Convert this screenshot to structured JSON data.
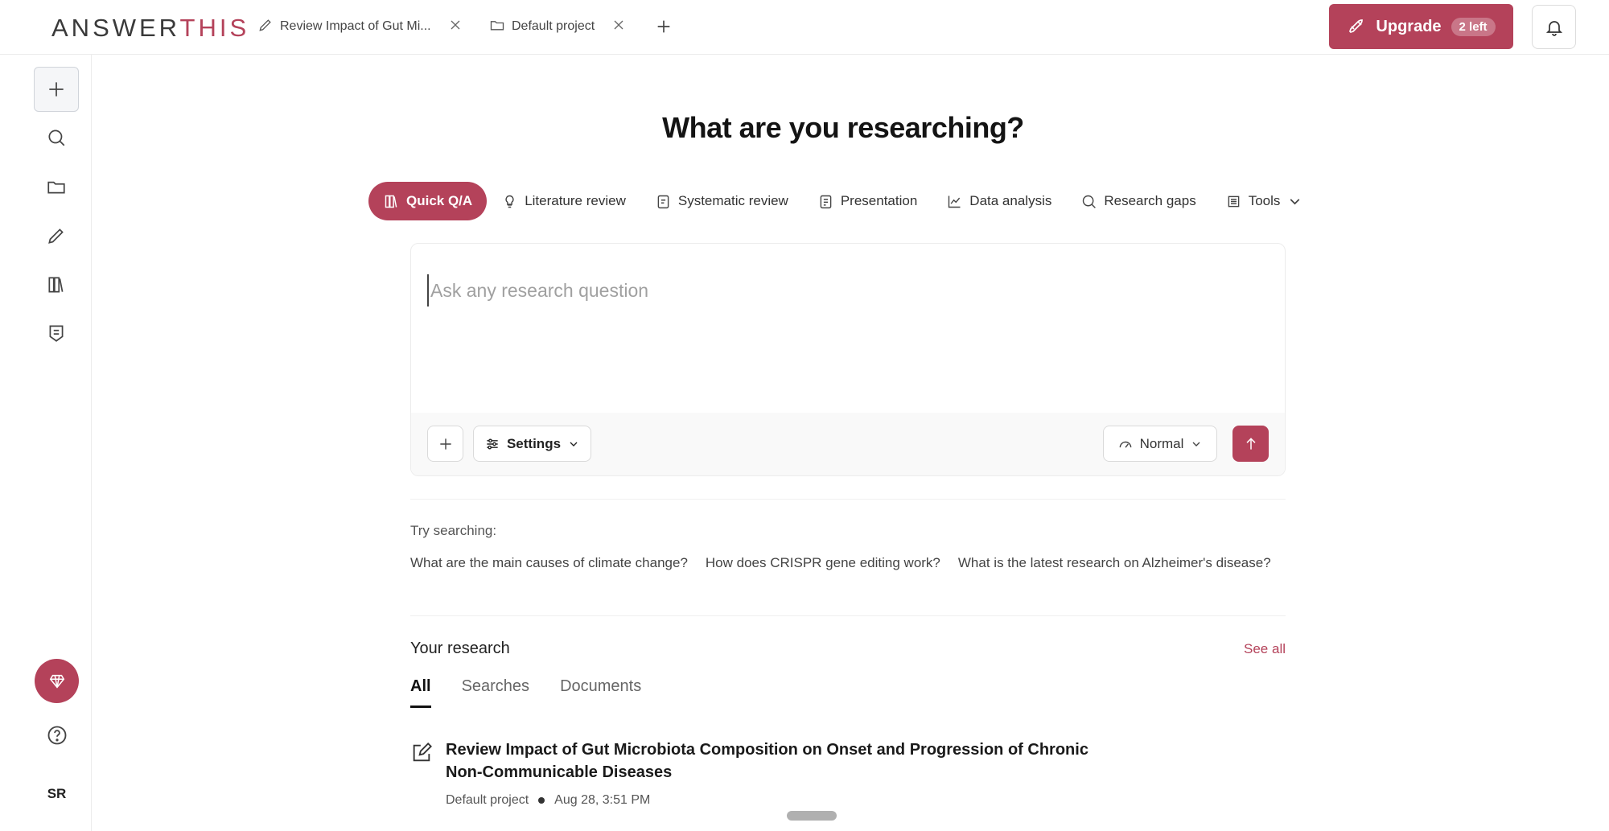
{
  "brand": {
    "logo_main": "ANSWER",
    "logo_accent": "THIS"
  },
  "tabs": [
    {
      "label": "Review Impact of Gut Mi...",
      "icon": "pencil-icon"
    },
    {
      "label": "Default project",
      "icon": "folder-icon"
    }
  ],
  "upgrade": {
    "label": "Upgrade",
    "badge": "2 left"
  },
  "sidebar": {
    "items": [
      "new-icon",
      "search-icon",
      "folder-icon",
      "pencil-icon",
      "library-icon",
      "notes-icon"
    ],
    "user_initials": "SR"
  },
  "main": {
    "title": "What are you researching?",
    "modes": [
      {
        "label": "Quick Q/A",
        "active": true
      },
      {
        "label": "Literature review"
      },
      {
        "label": "Systematic review"
      },
      {
        "label": "Presentation"
      },
      {
        "label": "Data analysis"
      },
      {
        "label": "Research gaps"
      },
      {
        "label": "Tools"
      }
    ],
    "input": {
      "placeholder": "Ask any research question",
      "value": ""
    },
    "settings_label": "Settings",
    "speed_label": "Normal",
    "try_label": "Try searching:",
    "suggestions": [
      "What are the main causes of climate change?",
      "How does CRISPR gene editing work?",
      "What is the latest research on Alzheimer's disease?"
    ]
  },
  "research": {
    "title": "Your research",
    "see_all": "See all",
    "tabs": [
      "All",
      "Searches",
      "Documents"
    ],
    "items": [
      {
        "title": "Review Impact of Gut Microbiota Composition on Onset and Progression of Chronic Non-Communicable Diseases",
        "project": "Default project",
        "date": "Aug 28, 3:51 PM"
      }
    ]
  },
  "colors": {
    "accent": "#b4425a"
  }
}
